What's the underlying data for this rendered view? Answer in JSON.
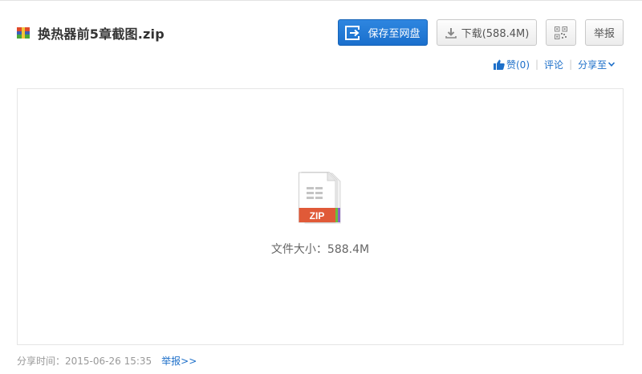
{
  "header": {
    "file_name": "换热器前5章截图.zip",
    "save_label": "保存至网盘",
    "download_label": "下载(588.4M)",
    "report_label": "举报",
    "icons": {
      "file": "archive-icon",
      "save": "save-to-cloud-icon",
      "download": "download-icon",
      "qr": "qr-code-icon"
    }
  },
  "share_bar": {
    "like_label": "赞(0)",
    "comment_label": "评论",
    "share_label": "分享至",
    "icons": {
      "like": "thumbs-up-icon",
      "share": "chevron-down-icon"
    }
  },
  "preview": {
    "file_type_badge": "ZIP",
    "size_label": "文件大小：",
    "size_value": "588.4M",
    "icon": "zip-file-icon"
  },
  "footer": {
    "share_time_label": "分享时间：",
    "share_time": "2015-06-26 15:35",
    "report_link": "举报>>"
  },
  "colors": {
    "primary": "#1a6fcc",
    "link": "#1d6fc9",
    "zip_badge": "#e05a38"
  }
}
